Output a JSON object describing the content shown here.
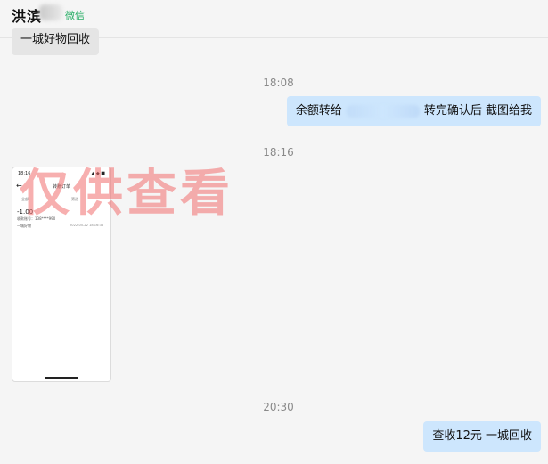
{
  "header": {
    "contact_name": "洪滨",
    "tag": "微信"
  },
  "messages": {
    "prev": "一城好物回收",
    "time1": "18:08",
    "msg1_part1": "余额转给",
    "msg1_part2": "转完确认后  截图给我",
    "time2": "18:16",
    "time3": "20:30",
    "msg3": "查收12元 一城回收"
  },
  "thumbnail": {
    "status_time": "18:16",
    "status_icons": "▲ ◆ ■",
    "back": "←",
    "title": "转账订单",
    "tab_left": "全部",
    "tab_right": "筛选",
    "amount": "-1.00",
    "line1": "收款账号：138****990",
    "line2": "一城好物",
    "date": "2022-05-22 18:16:36"
  },
  "watermark": {
    "text": "仅供查看"
  },
  "colors": {
    "bubble_self": "#cde6fd",
    "bubble_other": "#e5e5e5",
    "tag": "#2aae67",
    "watermark": "#f06e6e"
  }
}
